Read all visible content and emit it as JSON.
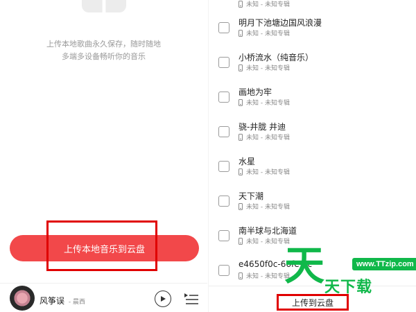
{
  "left": {
    "description_line1": "上传本地歌曲永久保存，随时随地",
    "description_line2": "多端多设备畅听你的音乐",
    "upload_button_label": "上传本地音乐到云盘",
    "player": {
      "song_title": "风筝误",
      "artist": "- 晨西",
      "play_icon": "play-icon",
      "playlist_icon": "playlist-icon"
    }
  },
  "right": {
    "songs": [
      {
        "title": "明月下池塘边国风浪漫",
        "meta": "未知 - 未知专辑"
      },
      {
        "title": "小桥流水（纯音乐）",
        "meta": "未知 - 未知专辑"
      },
      {
        "title": "画地为牢",
        "meta": "未知 - 未知专辑"
      },
      {
        "title": "骁-井胧 井迪",
        "meta": "未知 - 未知专辑"
      },
      {
        "title": "水星",
        "meta": "未知 - 未知专辑"
      },
      {
        "title": "天下潮",
        "meta": "未知 - 未知专辑"
      },
      {
        "title": "南半球与北海道",
        "meta": "未知 - 未知专辑"
      },
      {
        "title": "e4650f0c-66fe-4c",
        "meta": "未知 - 未知专辑"
      }
    ],
    "top_partial_meta": "未知 - 未知专辑",
    "upload_button_label": "上传到云盘"
  },
  "watermark": {
    "logo_glyph": "天",
    "url": "www.TTzip.com",
    "name": "天下载"
  },
  "colors": {
    "accent": "#f2484a",
    "highlight_box": "#e00000",
    "watermark": "#10b84a"
  }
}
